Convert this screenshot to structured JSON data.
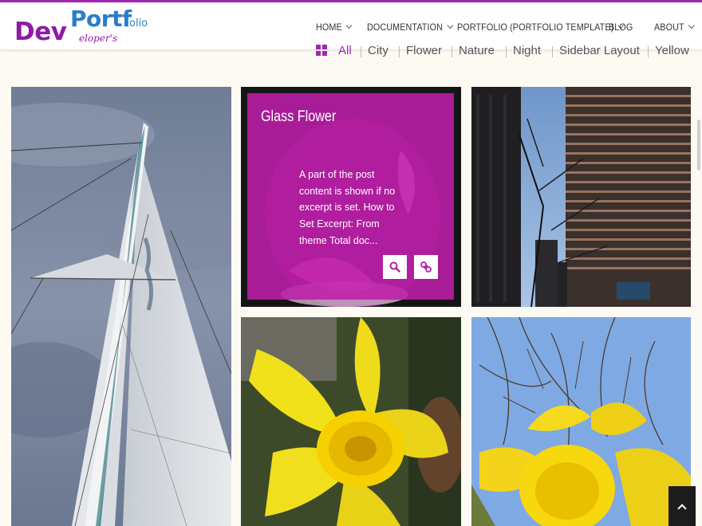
{
  "brand": {
    "logo_dev": "Dev",
    "logo_port": "Portf",
    "logo_olio": "olio",
    "logo_eloper": "eloper's",
    "accent_color": "#a326b5",
    "secondary_color": "#2a7ec9"
  },
  "nav": {
    "items": [
      {
        "label": "HOME",
        "has_dropdown": true
      },
      {
        "label": "DOCUMENTATION",
        "has_dropdown": true
      },
      {
        "label": "PORTFOLIO (PORTFOLIO TEMPLATE)",
        "has_dropdown": true
      },
      {
        "label": "BLOG",
        "has_dropdown": false
      },
      {
        "label": "ABOUT",
        "has_dropdown": true
      }
    ]
  },
  "filters": {
    "icon": "grid-icon",
    "items": [
      {
        "label": "All",
        "active": true
      },
      {
        "label": "City",
        "active": false
      },
      {
        "label": "Flower",
        "active": false
      },
      {
        "label": "Nature",
        "active": false
      },
      {
        "label": "Night",
        "active": false
      },
      {
        "label": "Sidebar Layout",
        "active": false
      },
      {
        "label": "Yellow",
        "active": false
      }
    ]
  },
  "portfolio": {
    "items": [
      {
        "image": "sailboat-mast"
      },
      {
        "image": "glass-flower",
        "overlay": {
          "title": "Glass Flower",
          "excerpt": "A part of the post content is shown if no excerpt is set. How to Set Excerpt: From theme Total doc...",
          "buttons": [
            "search-icon",
            "link-icon"
          ]
        }
      },
      {
        "image": "city-buildings"
      },
      {
        "image": "yellow-daffodil"
      },
      {
        "image": "daffodil-blue-sky"
      }
    ]
  },
  "scroll_top": {
    "icon": "chevron-up-icon"
  }
}
